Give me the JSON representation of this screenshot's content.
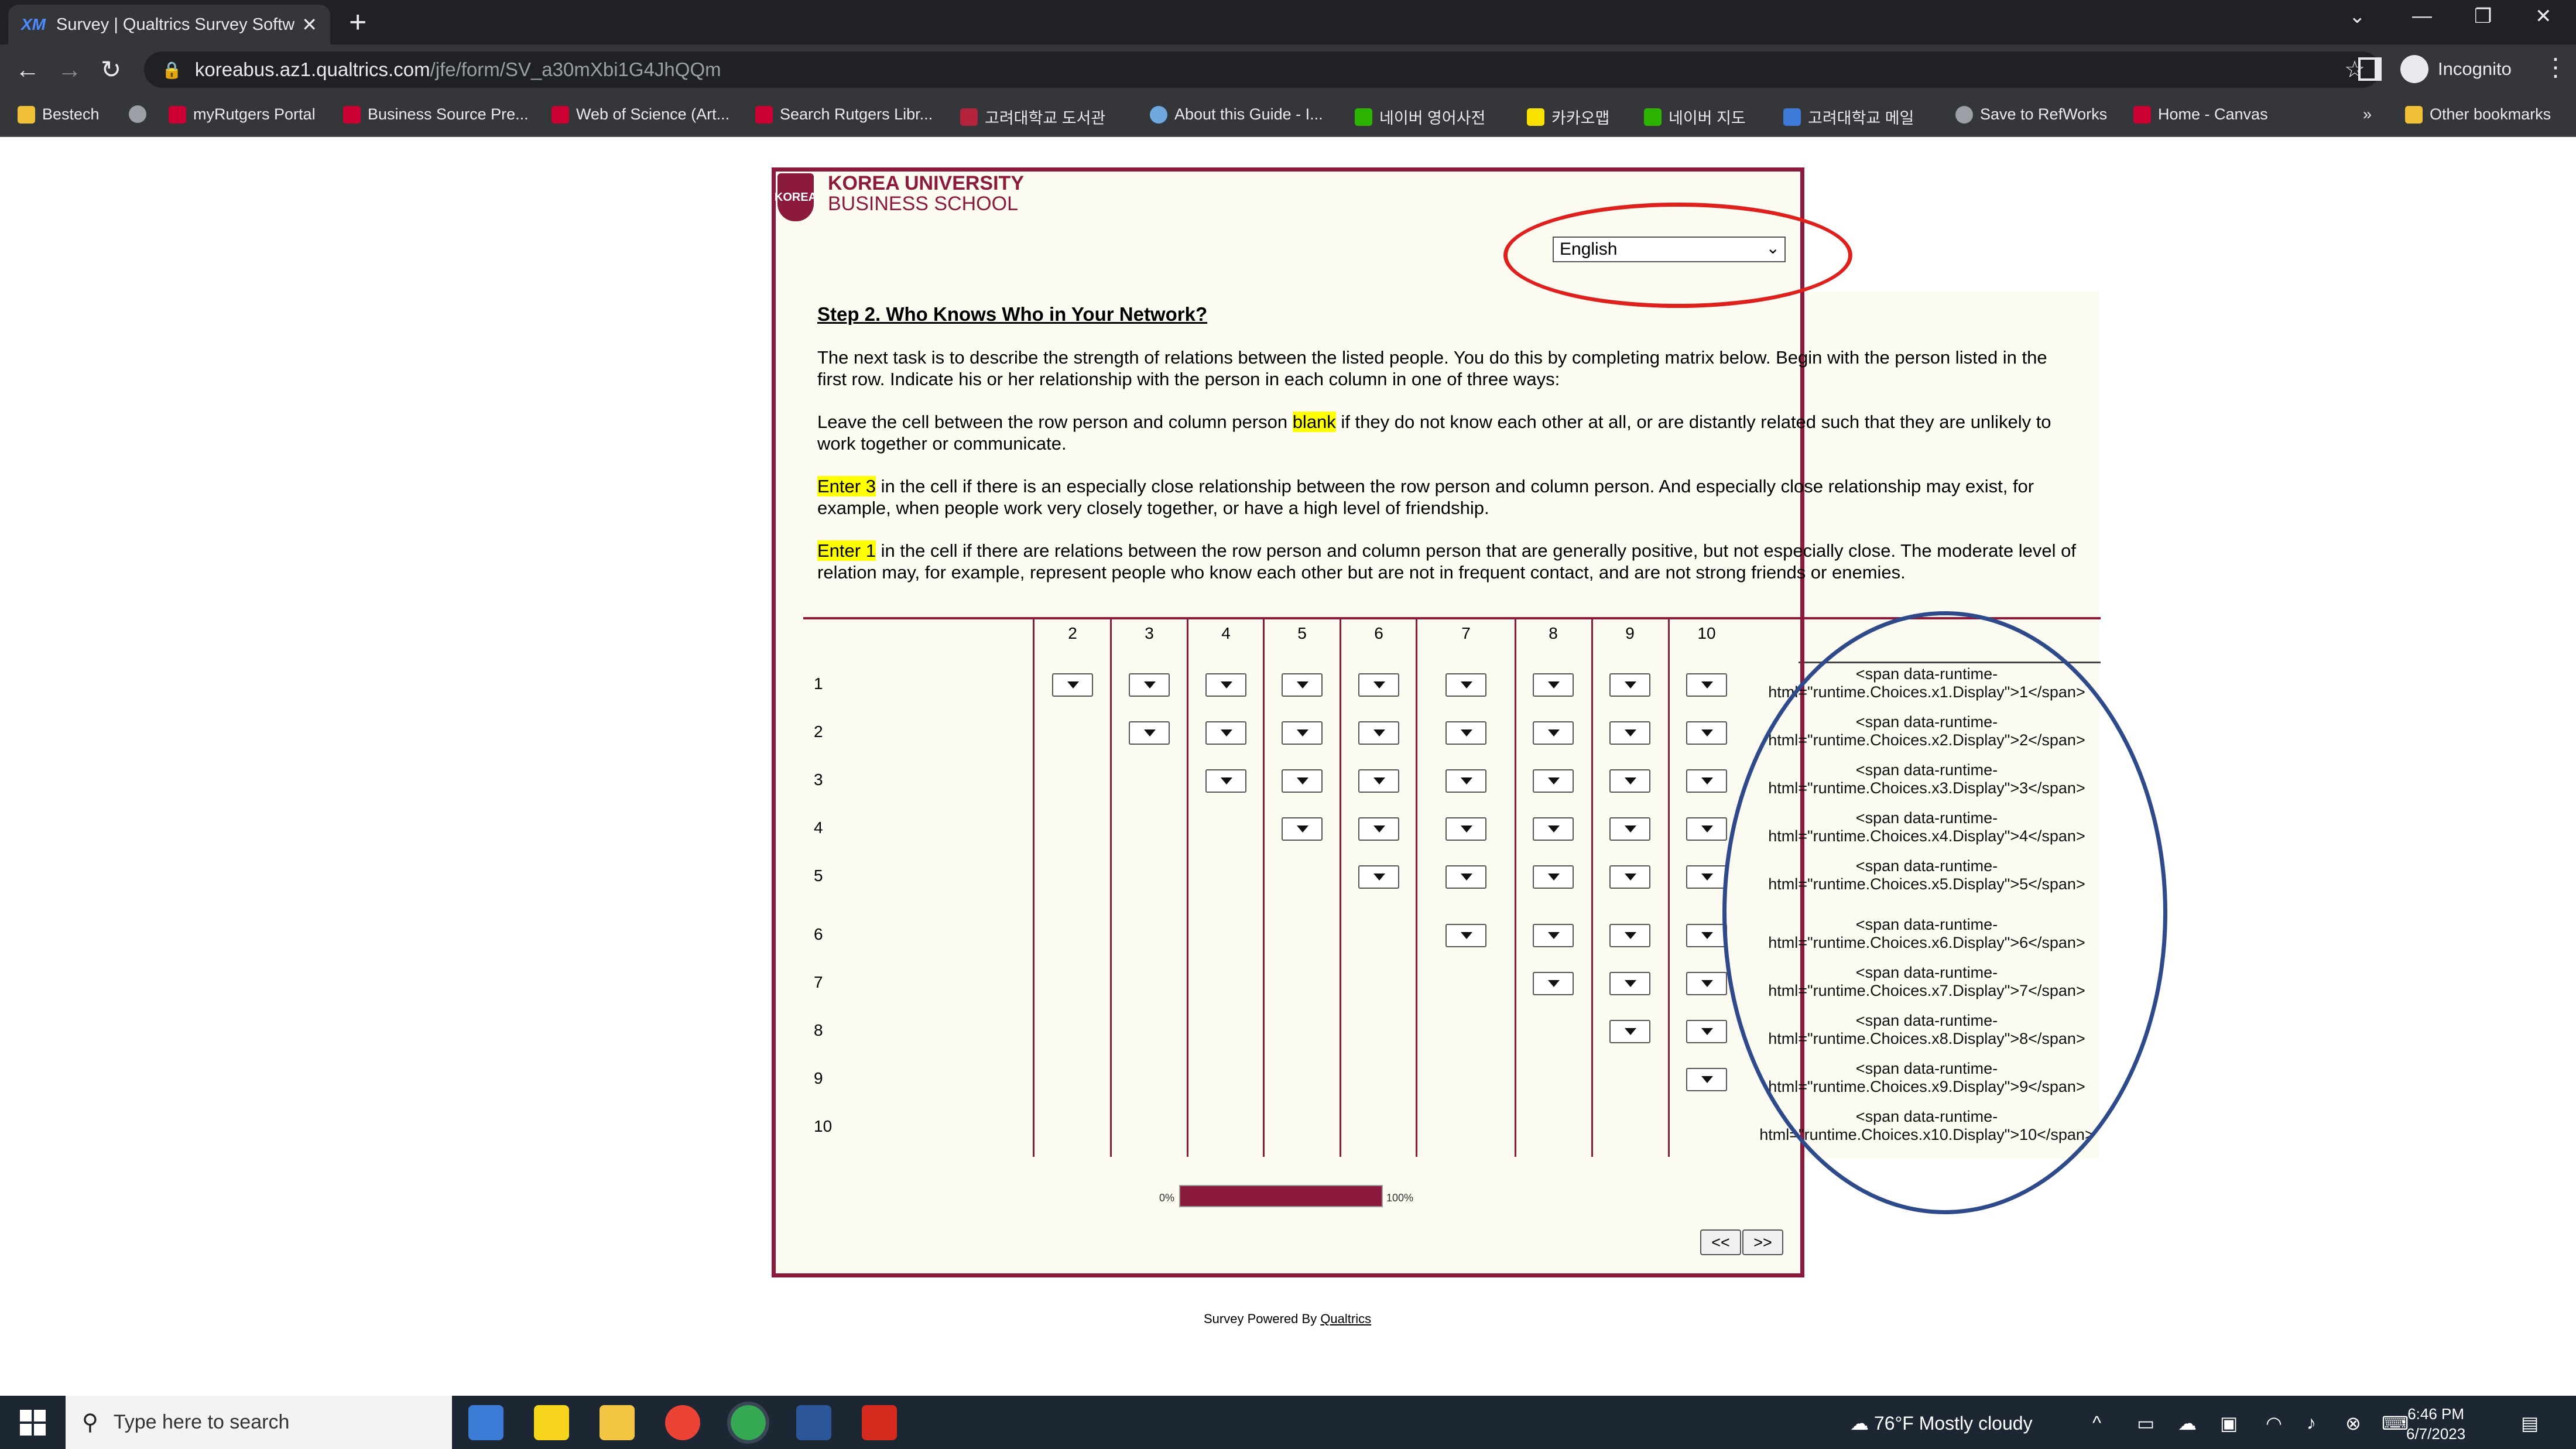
{
  "browser": {
    "tab_title": "Survey | Qualtrics Survey Softwar",
    "tab_favicon": "XM",
    "url_host": "koreabus.az1.qualtrics.com",
    "url_path": "/jfe/form/SV_a30mXbi1G4JhQQm",
    "profile_label": "Incognito",
    "bookmarks": [
      "Bestech",
      "myRutgers Portal",
      "Business Source Pre...",
      "Web of Science (Art...",
      "Search Rutgers Libr...",
      "고려대학교 도서관",
      "About this Guide - I...",
      "네이버 영어사전",
      "카카오맵",
      "네이버 지도",
      "고려대학교 메일",
      "Save to RefWorks",
      "Home - Canvas"
    ],
    "bookmarks_overflow": "»",
    "other_bookmarks": "Other bookmarks"
  },
  "survey": {
    "logo_line1": "KOREA UNIVERSITY",
    "logo_line2": "BUSINESS SCHOOL",
    "logo_crest": "KOREA",
    "language": "English",
    "title": "Step 2. Who Knows Who in Your Network?",
    "para1": "The next task is to describe the strength of relations between the listed people. You do this by completing matrix below. Begin with the person listed in the first row. Indicate his or her relationship with the person in each column in one of three ways:",
    "para2_pre": "Leave the cell between the row person and column person ",
    "para2_hl": "blank",
    "para2_post": " if they do not know each other at all, or are distantly related such that they are unlikely to work together or communicate.",
    "para3_hl": "Enter 3",
    "para3_post": " in the cell if there is an especially close relationship between the row person and column person. And especially close relationship may exist, for example, when people work very closely together, or have a high level of friendship.",
    "para4_hl": "Enter 1",
    "para4_post": " in the cell if there are relations between the row person and column person that are generally positive, but not especially close. The moderate level of relation may, for example, represent people who know each other but are not in frequent contact, and are not strong friends or enemies.",
    "columns": [
      "2",
      "3",
      "4",
      "5",
      "6",
      "7",
      "8",
      "9",
      "10"
    ],
    "rows": [
      "1",
      "2",
      "3",
      "4",
      "5",
      "6",
      "7",
      "8",
      "9",
      "10"
    ],
    "row_display_1": [
      "<span data-runtime-",
      "<span data-runtime-",
      "<span data-runtime-",
      "<span data-runtime-",
      "<span data-runtime-",
      "<span data-runtime-",
      "<span data-runtime-",
      "<span data-runtime-",
      "<span data-runtime-",
      "<span data-runtime-"
    ],
    "row_display_2": [
      "html=\"runtime.Choices.x1.Display\">1</span>",
      "html=\"runtime.Choices.x2.Display\">2</span>",
      "html=\"runtime.Choices.x3.Display\">3</span>",
      "html=\"runtime.Choices.x4.Display\">4</span>",
      "html=\"runtime.Choices.x5.Display\">5</span>",
      "html=\"runtime.Choices.x6.Display\">6</span>",
      "html=\"runtime.Choices.x7.Display\">7</span>",
      "html=\"runtime.Choices.x8.Display\">8</span>",
      "html=\"runtime.Choices.x9.Display\">9</span>",
      "html=\"runtime.Choices.x10.Display\">10</span>"
    ],
    "progress_min_label": "0%",
    "progress_max_label": "100%",
    "progress_fraction": 1.0,
    "back_label": "<<",
    "next_label": ">>",
    "footer_text": "Survey Powered By ",
    "footer_link": "Qualtrics"
  },
  "taskbar": {
    "search_placeholder": "Type here to search",
    "weather": "76°F  Mostly cloudy",
    "time": "6:46 PM",
    "date": "6/7/2023"
  },
  "colors": {
    "brand": "#8b1a3c",
    "highlight": "#ffff00",
    "annotation_red": "#e0201c",
    "annotation_blue": "#2e4a8a"
  }
}
